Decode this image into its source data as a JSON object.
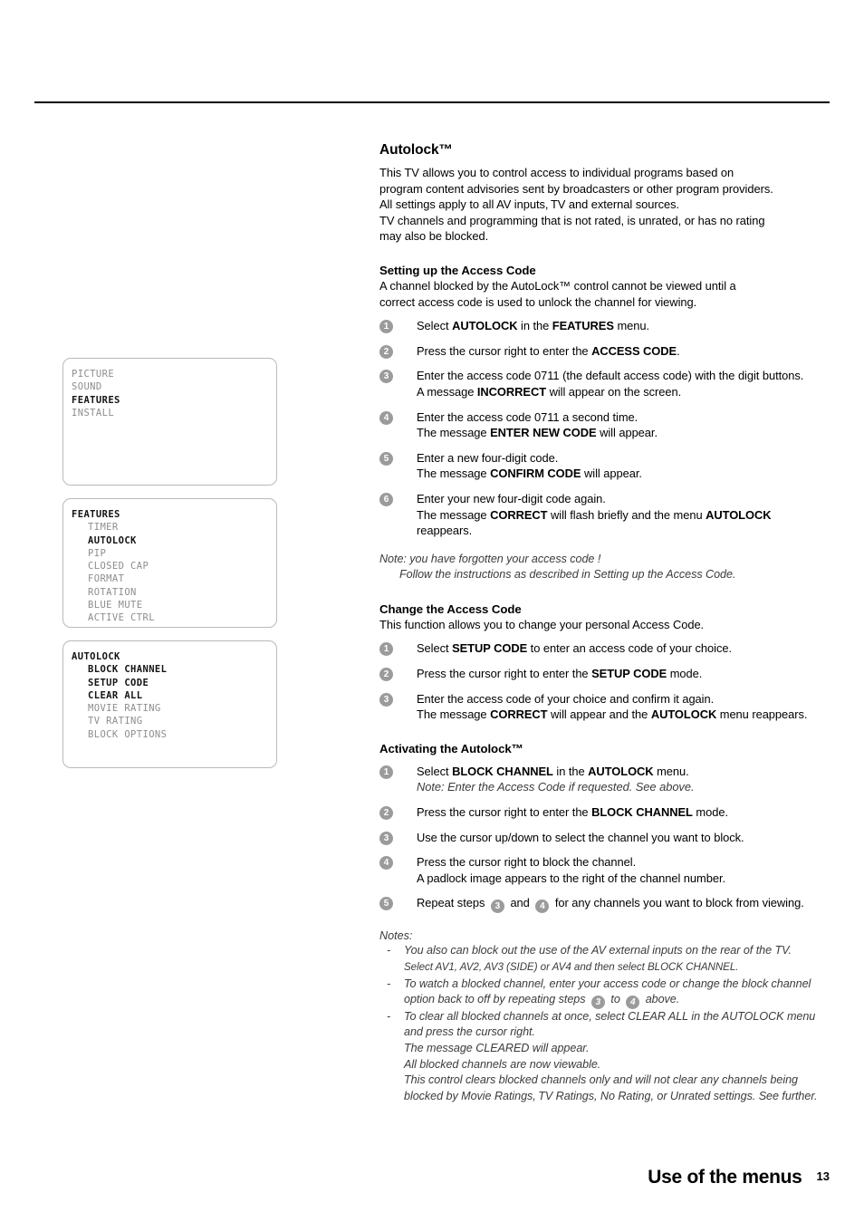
{
  "document": {
    "footer_title": "Use of the menus",
    "page_number": "13"
  },
  "menus": [
    {
      "name": "picture-menu",
      "rows": [
        {
          "label": "PICTURE",
          "level": "head",
          "highlight": false
        },
        {
          "label": "SOUND",
          "level": "head",
          "highlight": false
        },
        {
          "label": "FEATURES",
          "level": "head",
          "highlight": true
        },
        {
          "label": "INSTALL",
          "level": "head",
          "highlight": false
        }
      ]
    },
    {
      "name": "features-menu",
      "rows": [
        {
          "label": "FEATURES",
          "level": "head",
          "highlight": true
        },
        {
          "label": "TIMER",
          "level": "item",
          "highlight": false
        },
        {
          "label": "AUTOLOCK",
          "level": "item",
          "highlight": true
        },
        {
          "label": "PIP",
          "level": "item",
          "highlight": false
        },
        {
          "label": "CLOSED CAP",
          "level": "item",
          "highlight": false
        },
        {
          "label": "FORMAT",
          "level": "item",
          "highlight": false
        },
        {
          "label": "ROTATION",
          "level": "item",
          "highlight": false
        },
        {
          "label": "BLUE MUTE",
          "level": "item",
          "highlight": false
        },
        {
          "label": "ACTIVE CTRL",
          "level": "item",
          "highlight": false
        }
      ]
    },
    {
      "name": "autolock-menu",
      "rows": [
        {
          "label": "AUTOLOCK",
          "level": "head",
          "highlight": true
        },
        {
          "label": "BLOCK CHANNEL",
          "level": "item",
          "highlight": true
        },
        {
          "label": "SETUP CODE",
          "level": "item",
          "highlight": true
        },
        {
          "label": "CLEAR ALL",
          "level": "item",
          "highlight": true
        },
        {
          "label": "MOVIE RATING",
          "level": "item",
          "highlight": false
        },
        {
          "label": "TV RATING",
          "level": "item",
          "highlight": false
        },
        {
          "label": "BLOCK OPTIONS",
          "level": "item",
          "highlight": false
        }
      ]
    }
  ],
  "content": {
    "autolock": {
      "title": "Autolock™",
      "intro_lines": [
        "This TV allows you to control access to individual programs based on",
        "program content advisories sent by broadcasters or other program providers.",
        "All settings apply to all AV inputs, TV and external sources.",
        "TV channels and programming that is not rated, is unrated, or has no rating",
        "may also be blocked."
      ]
    },
    "setting_up": {
      "heading": "Setting up the Access Code",
      "intro_lines": [
        "A channel blocked by the AutoLock™ control cannot be viewed until a",
        "correct access code is used to unlock the channel for viewing."
      ],
      "steps": [
        {
          "num": "1",
          "line1_pre": "Select ",
          "line1_b1": "AUTOLOCK",
          "line1_mid": " in the ",
          "line1_b2": "FEATURES",
          "line1_post": " menu."
        },
        {
          "num": "2",
          "line1_pre": "Press the cursor right to enter the ",
          "line1_b1": "ACCESS CODE",
          "line1_mid": "",
          "line1_b2": "",
          "line1_post": "."
        },
        {
          "num": "3",
          "line1_pre": "Enter the access code 0711 (the default access code) with the digit buttons.",
          "line2_pre": "A message ",
          "line2_b1": "INCORRECT",
          "line2_post": " will appear on the screen."
        },
        {
          "num": "4",
          "line1_pre": "Enter the access code 0711 a second time.",
          "line2_pre": "The message ",
          "line2_b1": "ENTER NEW CODE",
          "line2_post": " will appear."
        },
        {
          "num": "5",
          "line1_pre": "Enter a new four-digit code.",
          "line2_pre": "The message ",
          "line2_b1": "CONFIRM CODE",
          "line2_post": " will appear."
        },
        {
          "num": "6",
          "line1_pre": "Enter your new four-digit code again.",
          "line2_pre": "The message ",
          "line2_b1": "CORRECT",
          "line2_mid": " will flash briefly and the menu ",
          "line2_b2": "AUTOLOCK",
          "line2_post": " reappears."
        }
      ],
      "note_line1": "Note: you have forgotten your access code !",
      "note_line2": "Follow the instructions as described in Setting up the Access Code."
    },
    "change_code": {
      "heading": "Change the Access Code",
      "intro": "This function allows you to change your personal Access Code.",
      "steps": [
        {
          "num": "1",
          "pre": "Select ",
          "b1": "SETUP CODE",
          "post": " to enter an access code of your choice."
        },
        {
          "num": "2",
          "pre": "Press the cursor right to enter the ",
          "b1": "SETUP CODE",
          "post": " mode."
        },
        {
          "num": "3",
          "line1": "Enter the access code of your choice and confirm it again.",
          "line2_pre": "The message ",
          "line2_b1": "CORRECT",
          "line2_mid": " will appear and the ",
          "line2_b2": "AUTOLOCK",
          "line2_post": " menu reappears."
        }
      ]
    },
    "activating": {
      "heading": "Activating the Autolock™",
      "steps": [
        {
          "num": "1",
          "pre": "Select ",
          "b1": "BLOCK CHANNEL",
          "mid": " in the ",
          "b2": "AUTOLOCK",
          "post": " menu.",
          "note": "Note: Enter the Access Code if requested. See above."
        },
        {
          "num": "2",
          "pre": "Press the cursor right to enter the ",
          "b1": "BLOCK CHANNEL",
          "post": " mode."
        },
        {
          "num": "3",
          "pre": "Use the cursor up/down to select the channel you want to block."
        },
        {
          "num": "4",
          "line1": "Press the cursor right to block the channel.",
          "line2": "A padlock image appears to the right of the channel number."
        },
        {
          "num": "5",
          "pre": "Repeat steps ",
          "badge_a": "3",
          "mid": " and ",
          "badge_b": "4",
          "post": " for any channels you want to block from viewing."
        }
      ]
    },
    "notes": {
      "heading": "Notes:",
      "items": [
        {
          "lines": [
            "You also can block out the use of the AV external inputs on the rear of the TV.",
            "Select AV1, AV2, AV3 (SIDE) or AV4 and then select BLOCK CHANNEL."
          ]
        },
        {
          "lines": [
            "To watch a blocked channel, enter your access code or change the block channel"
          ],
          "badge_line": {
            "pre": "option back to off by repeating steps ",
            "badge_a": "3",
            "mid": " to ",
            "badge_b": "4",
            "post": " above."
          }
        },
        {
          "lines": [
            "To clear all blocked channels at once, select CLEAR ALL in the AUTOLOCK menu",
            "and press the cursor right.",
            "The message CLEARED will appear.",
            "All blocked channels are now viewable.",
            "This control clears blocked channels only and will not clear any channels being",
            "blocked by Movie Ratings, TV Ratings, No Rating, or Unrated settings. See further."
          ]
        }
      ]
    }
  }
}
